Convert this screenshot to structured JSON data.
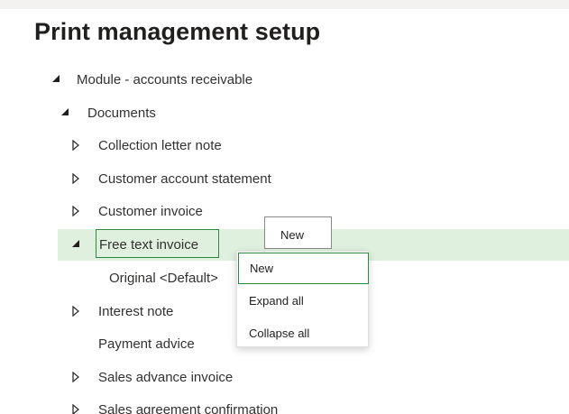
{
  "page": {
    "title": "Print management setup"
  },
  "tree": {
    "module": {
      "label": "Module - accounts receivable",
      "expanded": true
    },
    "documents": {
      "label": "Documents",
      "expanded": true
    },
    "items": [
      {
        "label": "Collection letter note",
        "expanded": false
      },
      {
        "label": "Customer account statement",
        "expanded": false
      },
      {
        "label": "Customer invoice",
        "expanded": false
      },
      {
        "label": "Free text invoice",
        "expanded": true,
        "selected": true
      },
      {
        "label": "Original <Default>",
        "child": true
      },
      {
        "label": "Interest note",
        "expanded": false
      },
      {
        "label": "Payment advice",
        "leaf": true
      },
      {
        "label": "Sales advance invoice",
        "expanded": false
      },
      {
        "label": "Sales agreement confirmation",
        "expanded": false
      }
    ]
  },
  "tooltip": {
    "text": "New"
  },
  "context_menu": {
    "items": [
      {
        "label": "New",
        "focused": true
      },
      {
        "label": "Expand all"
      },
      {
        "label": "Collapse all"
      }
    ]
  },
  "colors": {
    "selected_row": "#dff0df",
    "focus_border": "#2b8a3e",
    "text": "#323130",
    "title": "#201f1e"
  },
  "icons": {
    "expanded": "triangle-down-filled-icon",
    "collapsed": "triangle-right-outline-icon"
  }
}
